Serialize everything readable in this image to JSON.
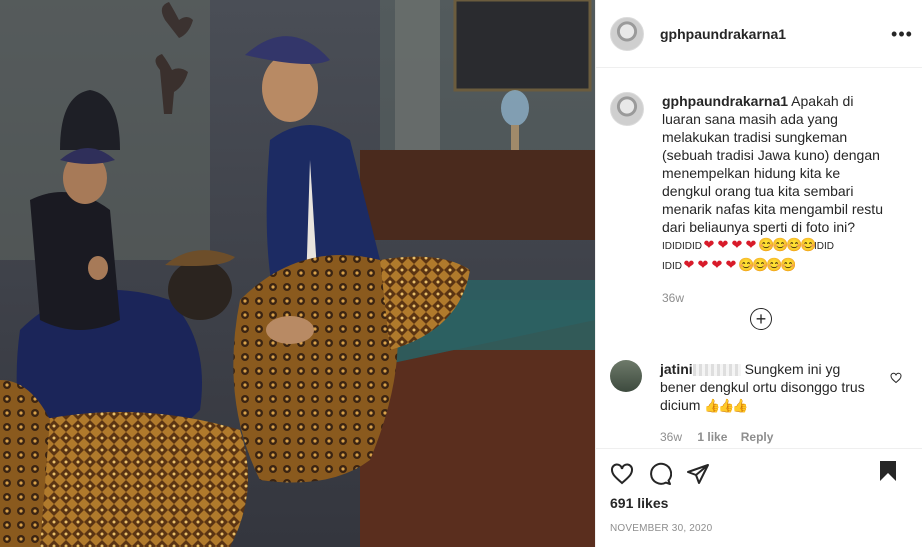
{
  "post": {
    "username": "gphpaundrakarna1",
    "more_label": "•••"
  },
  "caption": {
    "username": "gphpaundrakarna1",
    "text": "Apakah di luaran sana masih ada yang melakukan tradisi sungkeman (sebuah tradisi Jawa kuno) dengan menempelkan hidung kita ke dengkul orang tua kita sembari menarik nafas kita mengambil restu dari beliaunya sperti di foto ini?",
    "emoji_line1_prefix": "IDIDIDID",
    "emoji_line1": [
      "❤",
      "❤",
      "❤",
      "❤",
      "😊",
      "😊",
      "😊",
      "😊"
    ],
    "emoji_line1_suffix": "IDID",
    "emoji_line2_prefix": "IDID",
    "emoji_line2": [
      "❤",
      "❤",
      "❤",
      "❤",
      "😊",
      "😊",
      "😊",
      "😊"
    ],
    "time": "36w"
  },
  "load_more_label": "+",
  "comment": {
    "username": "jatini",
    "text": "Sungkem ini yg bener dengkul ortu disonggo trus dicium",
    "emoji": [
      "👍",
      "👍",
      "👍"
    ],
    "time": "36w",
    "likes": "1 like",
    "reply": "Reply"
  },
  "actions": {
    "likes": "691 likes",
    "date": "NOVEMBER 30, 2020"
  },
  "icons": {
    "like": "heart-icon",
    "comment": "comment-icon",
    "share": "share-icon",
    "save": "bookmark-icon",
    "options": "more-icon",
    "add": "plus-circle-icon"
  }
}
